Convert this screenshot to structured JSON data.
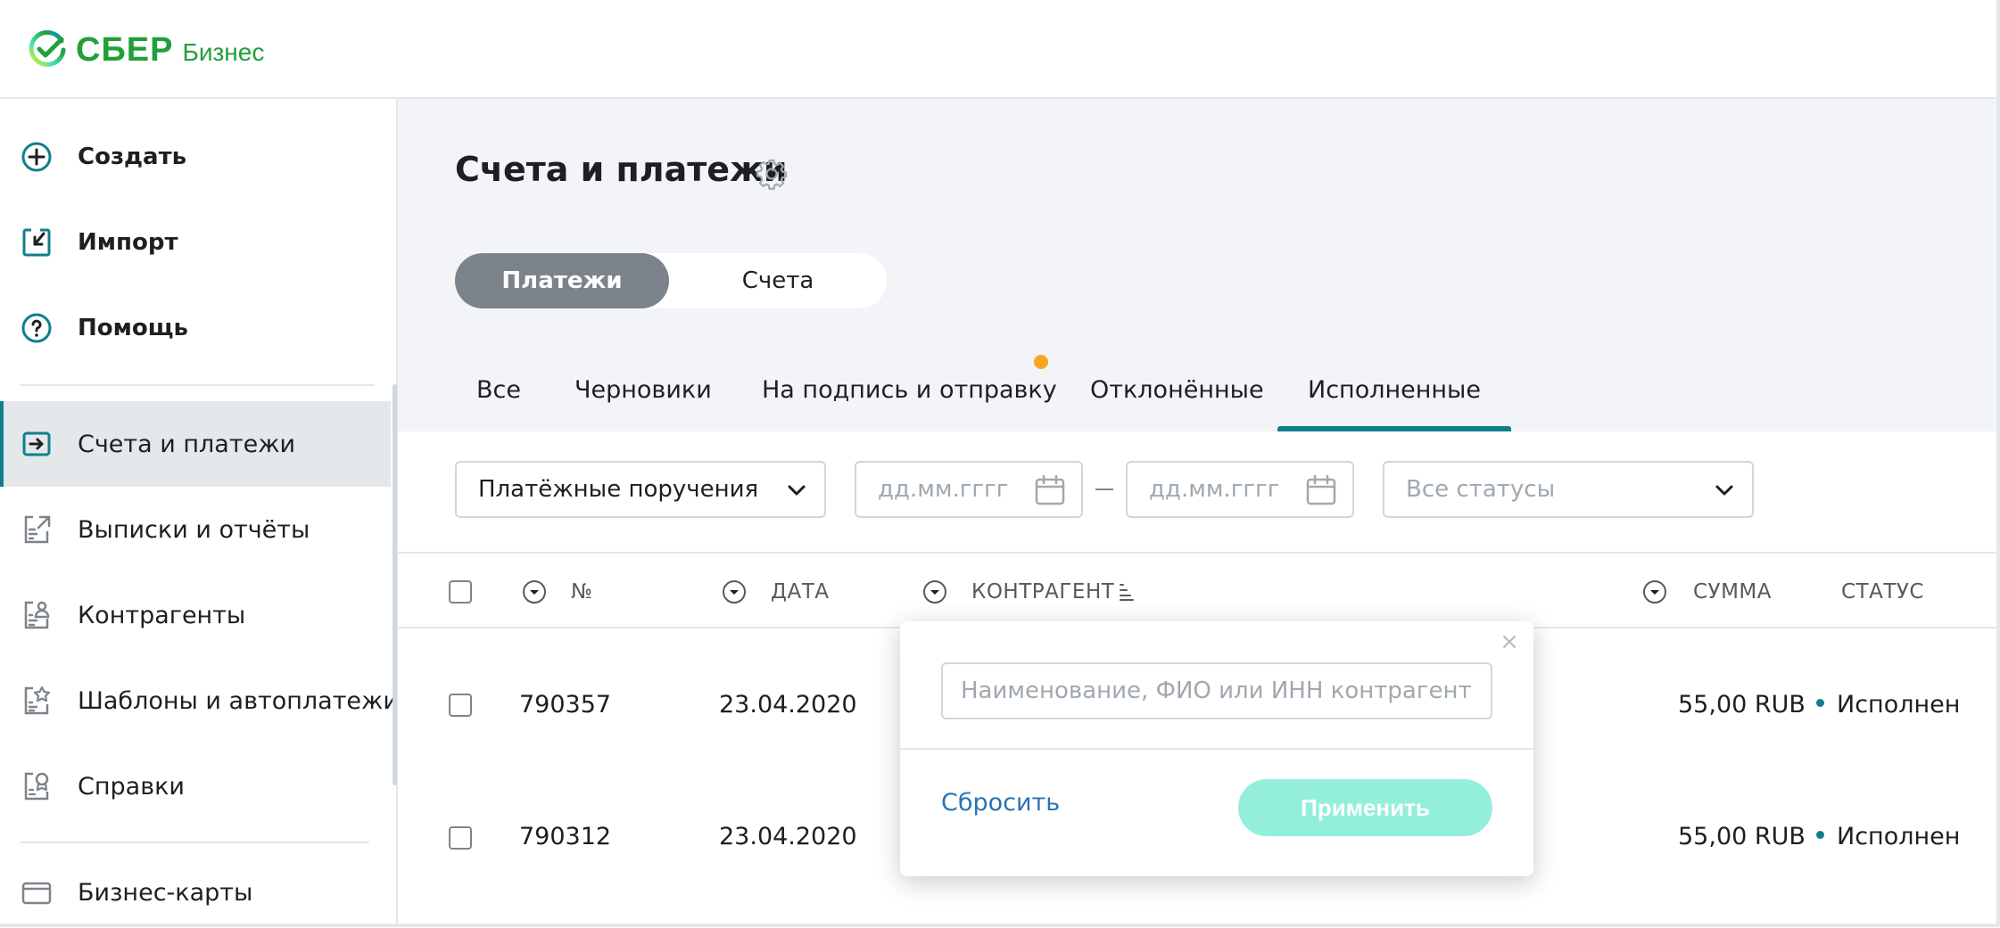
{
  "brand": {
    "name": "СБЕР",
    "sub": "Бизнес",
    "color": "#21a038"
  },
  "sidebar": {
    "actions": [
      {
        "label": "Создать",
        "icon": "plus-circle-icon"
      },
      {
        "label": "Импорт",
        "icon": "import-icon"
      },
      {
        "label": "Помощь",
        "icon": "help-circle-icon"
      }
    ],
    "items": [
      {
        "label": "Счета и платежи",
        "icon": "payments-icon",
        "active": true
      },
      {
        "label": "Выписки и отчёты",
        "icon": "statements-icon"
      },
      {
        "label": "Контрагенты",
        "icon": "contractors-icon"
      },
      {
        "label": "Шаблоны и автоплатежи",
        "icon": "templates-icon"
      },
      {
        "label": "Справки",
        "icon": "certificates-icon"
      }
    ],
    "bottom_items": [
      {
        "label": "Бизнес-карты",
        "icon": "card-icon"
      }
    ]
  },
  "page": {
    "title": "Счета и платежи",
    "segment": {
      "active": "Платежи",
      "inactive": "Счета"
    },
    "tabs": [
      "Все",
      "Черновики",
      "На подпись и отправку",
      "Отклонённые",
      "Исполненные"
    ],
    "active_tab": "Исполненные",
    "accent": "#107f8c"
  },
  "filters": {
    "doc_type": "Платёжные поручения",
    "date_from_placeholder": "дд.мм.гггг",
    "date_to_placeholder": "дд.мм.гггг",
    "status_placeholder": "Все статусы"
  },
  "table": {
    "columns": {
      "number": "№",
      "date": "ДАТА",
      "contractor": "КОНТРАГЕНТ",
      "amount": "СУММА",
      "status": "СТАТУС"
    },
    "rows": [
      {
        "number": "790357",
        "date": "23.04.2020",
        "amount": "55,00 RUB",
        "status": "Исполнен"
      },
      {
        "number": "790312",
        "date": "23.04.2020",
        "amount": "55,00 RUB",
        "status": "Исполнен"
      }
    ]
  },
  "popup": {
    "placeholder": "Наименование, ФИО или ИНН контрагента",
    "reset": "Сбросить",
    "apply": "Применить",
    "close": "×"
  }
}
